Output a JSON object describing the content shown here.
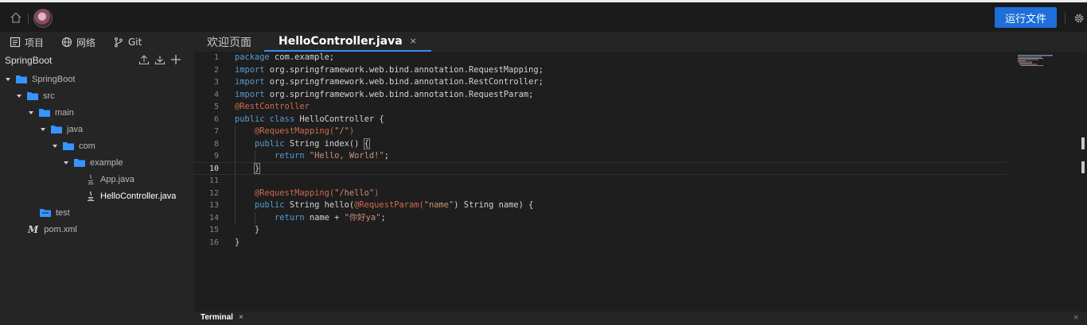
{
  "topbar": {
    "run_label": "运行文件"
  },
  "sidebar": {
    "tabs": [
      {
        "label": "项目",
        "icon": "list-icon"
      },
      {
        "label": "网络",
        "icon": "globe-icon"
      },
      {
        "label": "Git",
        "icon": "git-branch-icon"
      }
    ],
    "project_title": "SpringBoot",
    "tree": [
      {
        "label": "SpringBoot",
        "type": "folder"
      },
      {
        "label": "src",
        "type": "folder"
      },
      {
        "label": "main",
        "type": "folder"
      },
      {
        "label": "java",
        "type": "folder"
      },
      {
        "label": "com",
        "type": "folder"
      },
      {
        "label": "example",
        "type": "folder"
      },
      {
        "label": "App.java",
        "type": "java-file"
      },
      {
        "label": "HelloController.java",
        "type": "java-file",
        "active": true
      },
      {
        "label": "test",
        "type": "folder"
      },
      {
        "label": "pom.xml",
        "type": "maven-file"
      }
    ]
  },
  "editor": {
    "tabs": [
      {
        "label": "欢迎页面"
      },
      {
        "label": "HelloController.java",
        "close": "×",
        "active": true
      }
    ],
    "line_numbers": [
      "1",
      "2",
      "3",
      "4",
      "5",
      "6",
      "7",
      "8",
      "9",
      "10",
      "11",
      "12",
      "13",
      "14",
      "15",
      "16"
    ],
    "current_line": "10",
    "code": {
      "l1a": "package",
      "l1b": " com.example;",
      "l2a": "import",
      "l2b": " org.springframework.web.bind.annotation.RequestMapping;",
      "l3a": "import",
      "l3b": " org.springframework.web.bind.annotation.RestController;",
      "l4a": "import",
      "l4b": " org.springframework.web.bind.annotation.RequestParam;",
      "l5": "@RestController",
      "l6a": "public class",
      "l6b": " HelloController {",
      "l7a": "    @RequestMapping(",
      "l7b": "\"/\"",
      "l7c": ")",
      "l8a": "    public",
      "l8b": " String index() ",
      "l8c": "{",
      "l9a": "        return",
      "l9b": " ",
      "l9c": "\"Hello, World!\"",
      "l9d": ";",
      "l10a": "    ",
      "l10b": "}",
      "l12a": "    @RequestMapping(",
      "l12b": "\"/hello\"",
      "l12c": ")",
      "l13a": "    public",
      "l13b": " String hello(",
      "l13c": "@RequestParam(",
      "l13d": "\"name\"",
      "l13e": ") String name) {",
      "l14a": "        return",
      "l14b": " name + ",
      "l14c": "\"你好ya\"",
      "l14d": ";",
      "l15": "    }",
      "l16": "}"
    }
  },
  "terminal": {
    "tab_label": "Terminal",
    "close": "×",
    "panel_close": "×"
  },
  "colors": {
    "accent": "#1e6fd9",
    "keyword": "#569cd6",
    "annotation": "#ce6a4e",
    "string": "#ce9178",
    "folder": "#3794ff"
  }
}
